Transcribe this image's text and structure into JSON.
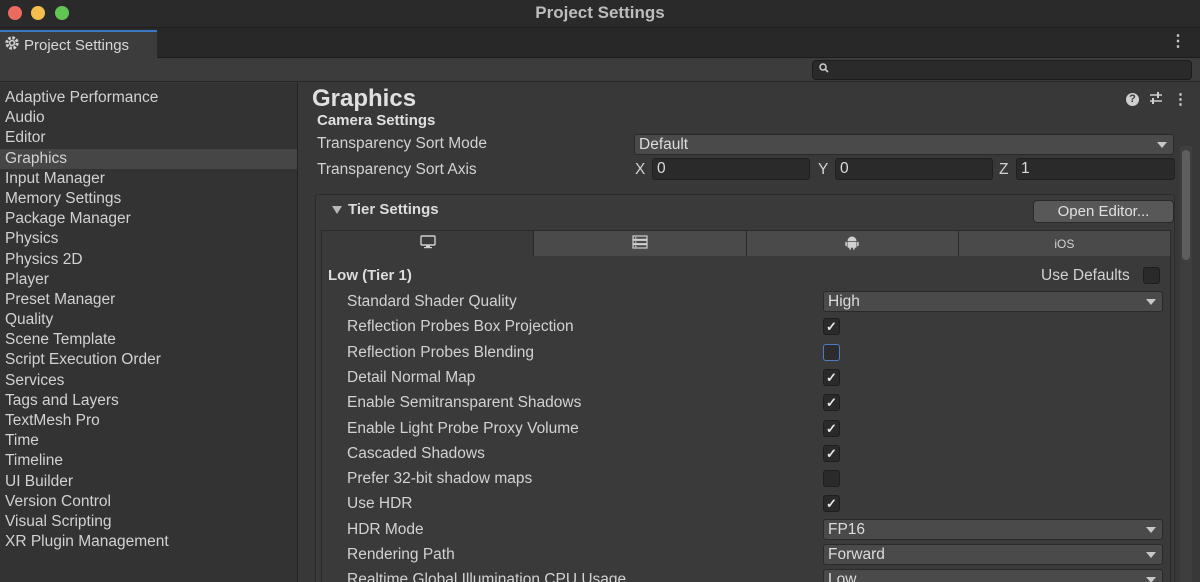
{
  "window": {
    "title": "Project Settings"
  },
  "tab": {
    "label": "Project Settings",
    "icon": "gear-icon"
  },
  "sidebar": {
    "items": [
      {
        "label": "Adaptive Performance"
      },
      {
        "label": "Audio"
      },
      {
        "label": "Editor"
      },
      {
        "label": "Graphics",
        "selected": true
      },
      {
        "label": "Input Manager"
      },
      {
        "label": "Memory Settings"
      },
      {
        "label": "Package Manager"
      },
      {
        "label": "Physics"
      },
      {
        "label": "Physics 2D"
      },
      {
        "label": "Player"
      },
      {
        "label": "Preset Manager"
      },
      {
        "label": "Quality"
      },
      {
        "label": "Scene Template"
      },
      {
        "label": "Script Execution Order"
      },
      {
        "label": "Services"
      },
      {
        "label": "Tags and Layers"
      },
      {
        "label": "TextMesh Pro"
      },
      {
        "label": "Time"
      },
      {
        "label": "Timeline"
      },
      {
        "label": "UI Builder"
      },
      {
        "label": "Version Control"
      },
      {
        "label": "Visual Scripting"
      },
      {
        "label": "XR Plugin Management"
      }
    ]
  },
  "main": {
    "title": "Graphics",
    "camera_settings": {
      "heading": "Camera Settings",
      "sort_mode_label": "Transparency Sort Mode",
      "sort_mode_value": "Default",
      "sort_axis_label": "Transparency Sort Axis",
      "x_label": "X",
      "x_value": "0",
      "y_label": "Y",
      "y_value": "0",
      "z_label": "Z",
      "z_value": "1"
    },
    "tier_settings": {
      "heading": "Tier Settings",
      "open_editor_label": "Open Editor...",
      "platform_tabs": [
        {
          "icon": "monitor-icon",
          "label": ""
        },
        {
          "icon": "server-icon",
          "label": ""
        },
        {
          "icon": "android-icon",
          "label": ""
        },
        {
          "icon": "",
          "label": "iOS"
        }
      ],
      "tier_name": "Low (Tier 1)",
      "use_defaults_label": "Use Defaults",
      "use_defaults": false,
      "rows": [
        {
          "label": "Standard Shader Quality",
          "type": "dropdown",
          "value": "High"
        },
        {
          "label": "Reflection Probes Box Projection",
          "type": "check",
          "checked": true
        },
        {
          "label": "Reflection Probes Blending",
          "type": "check",
          "checked": false
        },
        {
          "label": "Detail Normal Map",
          "type": "check",
          "checked": true
        },
        {
          "label": "Enable Semitransparent Shadows",
          "type": "check",
          "checked": true
        },
        {
          "label": "Enable Light Probe Proxy Volume",
          "type": "check",
          "checked": true
        },
        {
          "label": "Cascaded Shadows",
          "type": "check",
          "checked": true
        },
        {
          "label": "Prefer 32-bit shadow maps",
          "type": "check",
          "checked": false
        },
        {
          "label": "Use HDR",
          "type": "check",
          "checked": true
        },
        {
          "label": "HDR Mode",
          "type": "dropdown",
          "value": "FP16"
        },
        {
          "label": "Rendering Path",
          "type": "dropdown",
          "value": "Forward"
        },
        {
          "label": "Realtime Global Illumination CPU Usage",
          "type": "dropdown",
          "value": "Low"
        }
      ]
    }
  },
  "colors": {
    "accent": "#3a78c2",
    "focus": "#4c7dc1",
    "background": "#383838"
  }
}
